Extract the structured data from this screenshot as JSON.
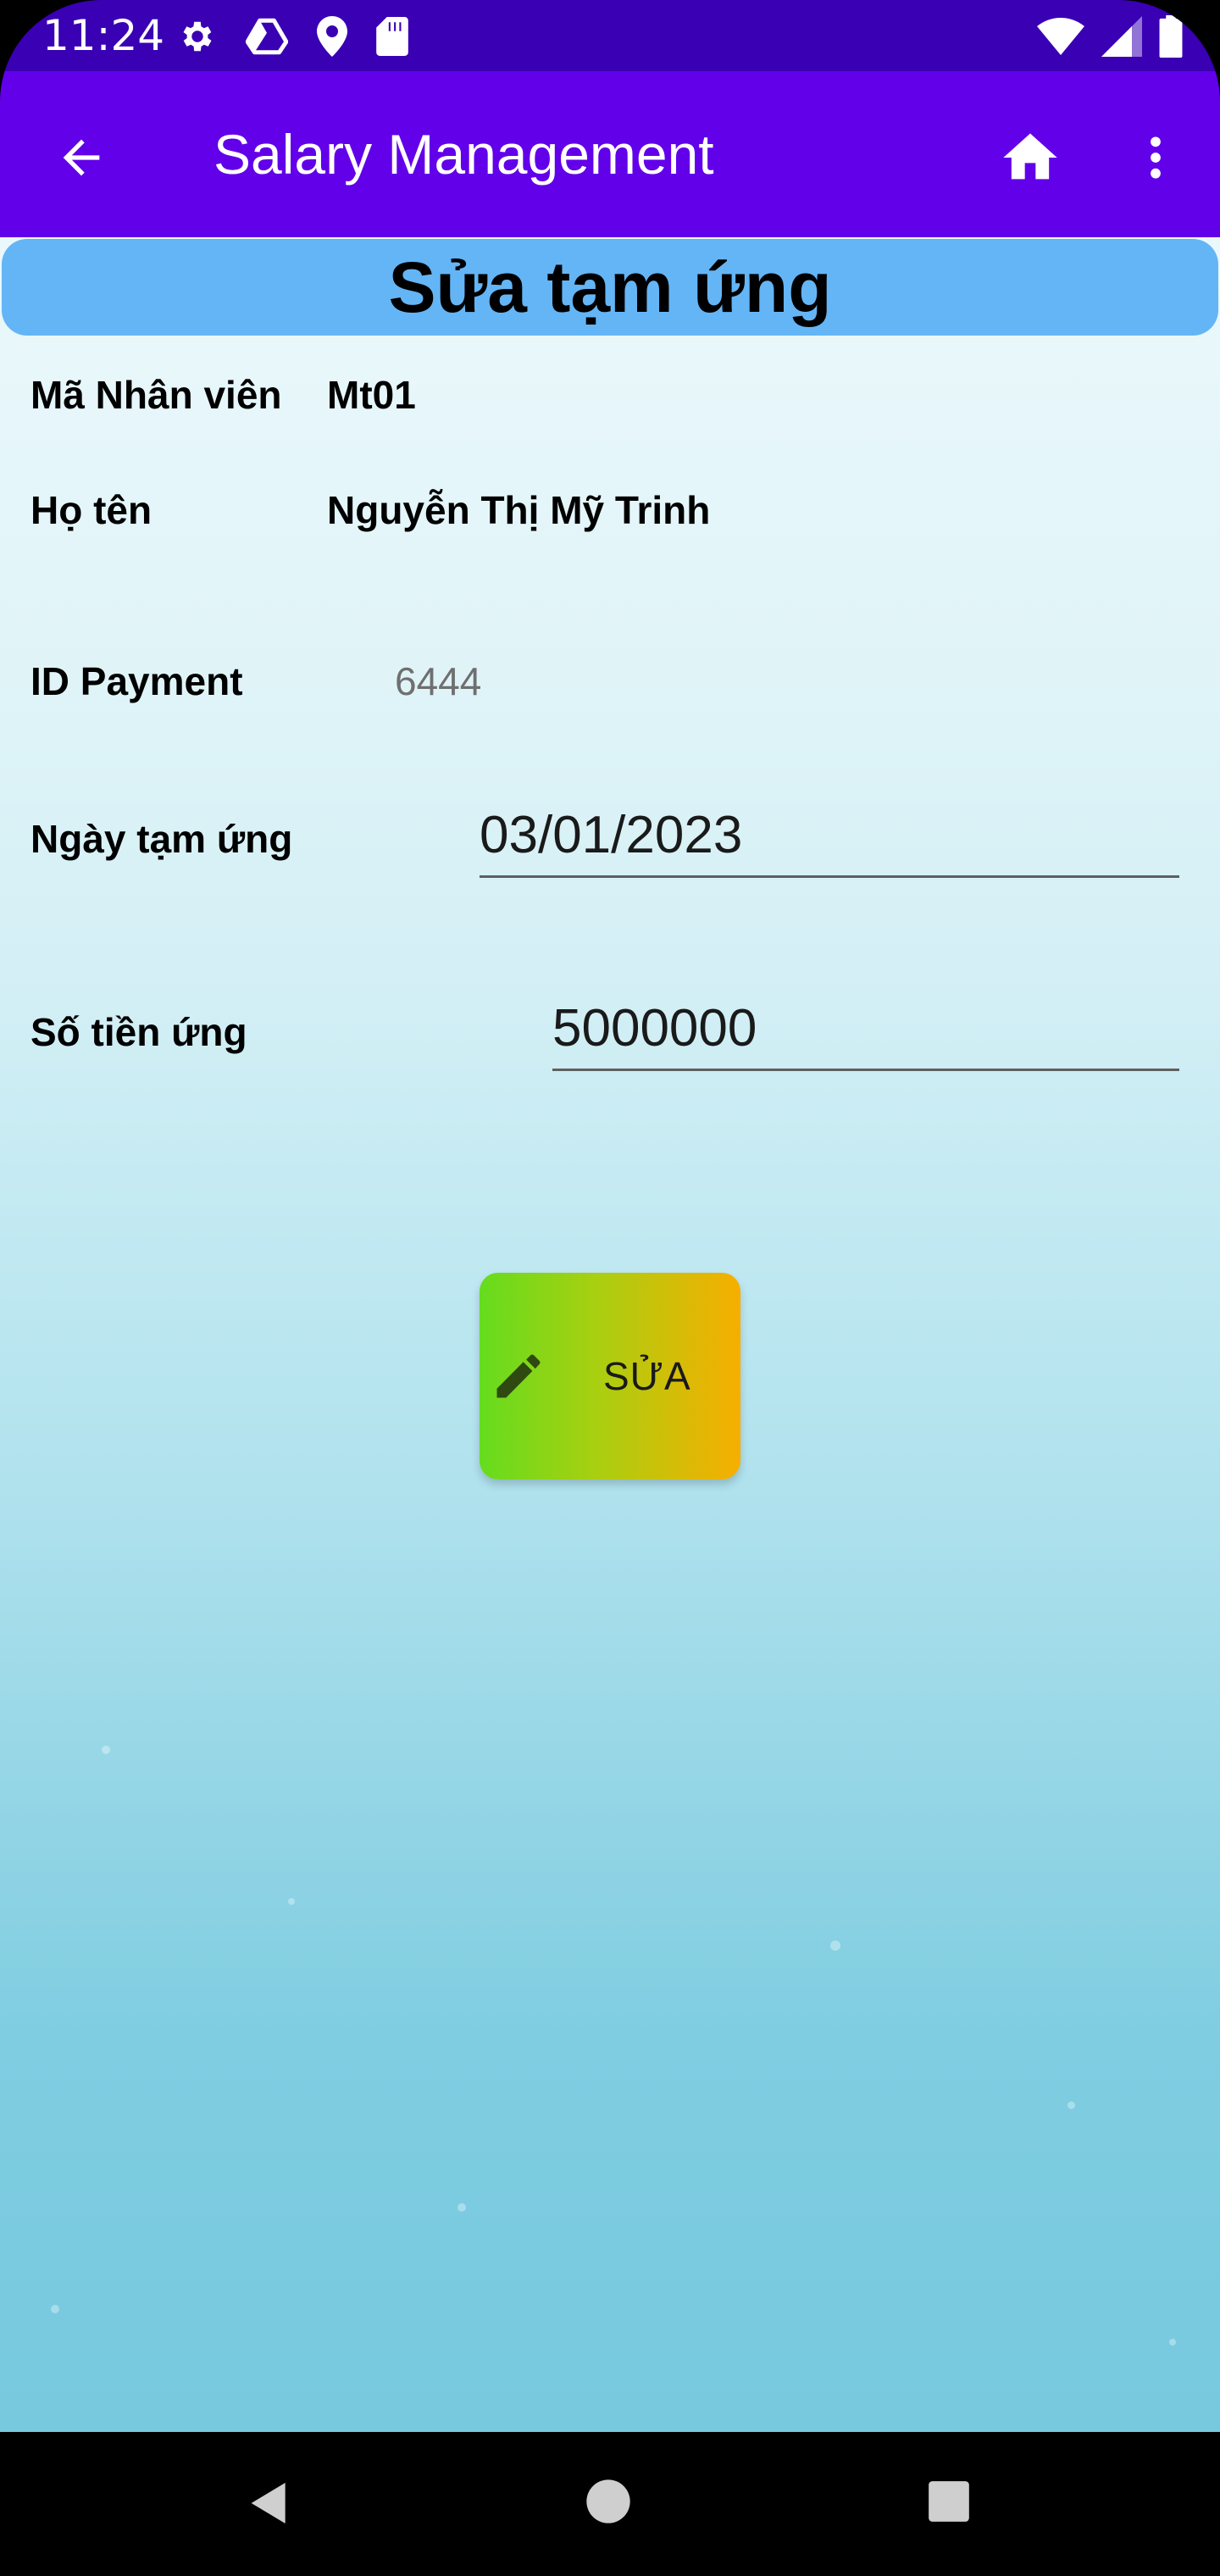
{
  "status_bar": {
    "time": "11:24",
    "left_icons": [
      "gear-icon",
      "drive-icon",
      "location-icon",
      "sd-card-icon"
    ],
    "right_icons": [
      "wifi-icon",
      "signal-icon",
      "battery-icon"
    ]
  },
  "app_bar": {
    "title": "Salary Management",
    "back_icon": "arrow-back-icon",
    "home_icon": "home-icon",
    "more_icon": "more-vert-icon",
    "color": "#6200ea"
  },
  "page": {
    "header": "Sửa tạm ứng",
    "employee_id_label": "Mã Nhân viên",
    "employee_id_value": "Mt01",
    "full_name_label": "Họ tên",
    "full_name_value": "Nguyễn Thị Mỹ Trinh",
    "payment_id_label": "ID Payment",
    "payment_id_value": "6444",
    "advance_date_label": "Ngày tạm ứng",
    "advance_date_value": "03/01/2023",
    "advance_amount_label": "Số tiền ứng",
    "advance_amount_value": "5000000",
    "edit_button_label": "SỬA",
    "edit_button_icon": "pencil-icon"
  },
  "nav_bar": {
    "icons": [
      "nav-back-icon",
      "nav-home-icon",
      "nav-recent-icon"
    ]
  }
}
